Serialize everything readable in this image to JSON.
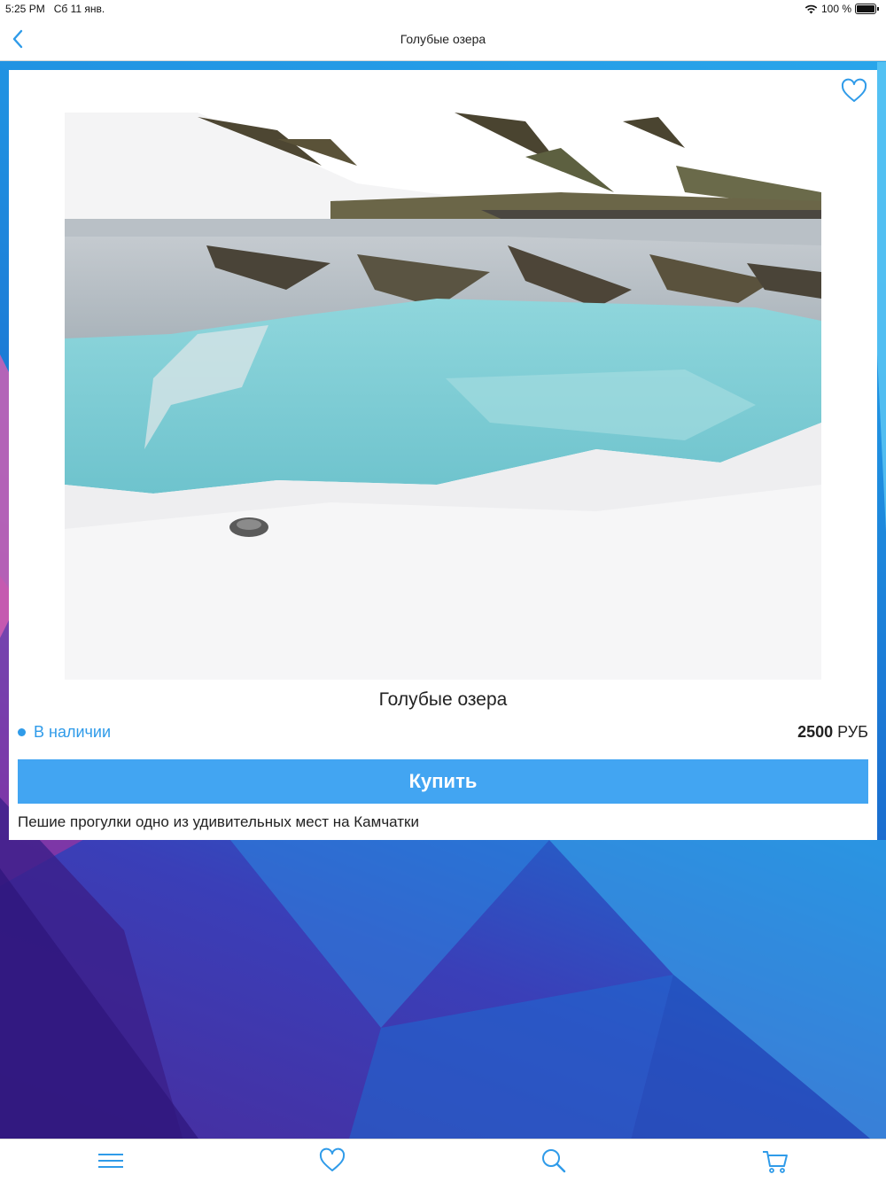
{
  "status_bar": {
    "time": "5:25 PM",
    "date": "Сб 11 янв.",
    "battery": "100 %",
    "icons": [
      "wifi-icon",
      "battery-icon"
    ]
  },
  "nav": {
    "title": "Голубые озера",
    "back_icon": "chevron-left-icon"
  },
  "product": {
    "title": "Голубые озера",
    "availability": "В наличии",
    "price_amount": "2500",
    "price_currency": "РУБ",
    "buy_label": "Купить",
    "description": "Пешие прогулки одно из удивительных мест на Камчатки",
    "favorite_icon": "heart-outline-icon",
    "photo_pages": 1,
    "photo_current_page": 1
  },
  "tab_bar": {
    "items": [
      {
        "icon": "menu-icon"
      },
      {
        "icon": "heart-icon"
      },
      {
        "icon": "search-icon"
      },
      {
        "icon": "cart-icon"
      }
    ]
  },
  "colors": {
    "accent": "#42a5f2",
    "availability": "#2f9be9"
  }
}
